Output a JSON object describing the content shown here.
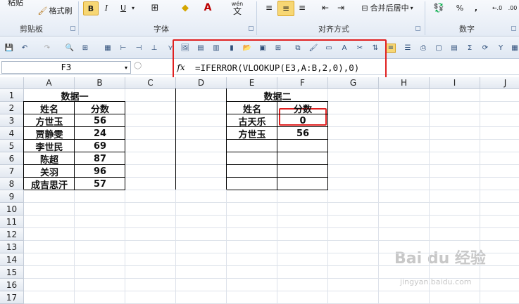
{
  "ribbon": {
    "paste_label": "粘贴",
    "format_painter": "格式刷",
    "bold": "B",
    "italic": "I",
    "underline": "U",
    "wen_label": "wén",
    "wen_char": "文",
    "merge_center": "合并后居中",
    "percent": "%",
    "comma": ",",
    "groups": {
      "clipboard": "剪贴板",
      "font": "字体",
      "alignment": "对齐方式",
      "number": "数字"
    }
  },
  "formula_bar": {
    "name_box": "F3",
    "fx": "fx",
    "formula": "=IFERROR(VLOOKUP(E3,A:B,2,0),0)"
  },
  "columns": [
    "A",
    "B",
    "C",
    "D",
    "E",
    "F",
    "G",
    "H",
    "I",
    "J"
  ],
  "rows": [
    "1",
    "2",
    "3",
    "4",
    "5",
    "6",
    "7",
    "8",
    "9",
    "10",
    "11",
    "12",
    "13",
    "14",
    "15",
    "16",
    "17"
  ],
  "table1": {
    "title": "数据一",
    "header_name": "姓名",
    "header_score": "分数",
    "rows": [
      {
        "name": "方世玉",
        "score": "56"
      },
      {
        "name": "贾静雯",
        "score": "24"
      },
      {
        "name": "李世民",
        "score": "69"
      },
      {
        "name": "陈超",
        "score": "87"
      },
      {
        "name": "关羽",
        "score": "96"
      },
      {
        "name": "成吉思汗",
        "score": "57"
      }
    ]
  },
  "table2": {
    "title": "数据二",
    "header_name": "姓名",
    "header_score": "分数",
    "rows": [
      {
        "name": "古天乐",
        "score": "0"
      },
      {
        "name": "方世玉",
        "score": "56"
      }
    ]
  },
  "watermark": {
    "brand": "Bai du 经验",
    "url": "jingyan.baidu.com"
  },
  "colors": {
    "highlight_red": "#e02020",
    "ribbon_bg": "#e4ebf5"
  }
}
